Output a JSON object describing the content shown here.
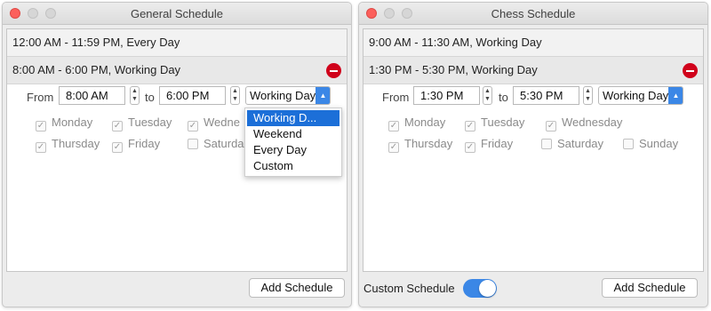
{
  "left": {
    "title": "General Schedule",
    "rows": [
      {
        "label": "12:00 AM - 11:59 PM, Every Day"
      },
      {
        "label": "8:00 AM - 6:00 PM, Working Day"
      }
    ],
    "editor": {
      "from_label": "From",
      "to_label": "to",
      "from_value": "8:00 AM",
      "to_value": "6:00 PM",
      "select_value": "Working Day",
      "days": [
        {
          "label": "Monday",
          "checked": true
        },
        {
          "label": "Tuesday",
          "checked": true
        },
        {
          "label": "Wedne",
          "checked": true
        },
        {
          "label": "Thursday",
          "checked": true
        },
        {
          "label": "Friday",
          "checked": true
        },
        {
          "label": "Saturda",
          "checked": false
        }
      ]
    },
    "dropdown": {
      "options": [
        "Working D...",
        "Weekend",
        "Every Day",
        "Custom"
      ],
      "selected_index": 0
    },
    "add_button": "Add Schedule"
  },
  "right": {
    "title": "Chess Schedule",
    "rows": [
      {
        "label": "9:00 AM - 11:30 AM, Working Day"
      },
      {
        "label": "1:30 PM - 5:30 PM, Working Day"
      }
    ],
    "editor": {
      "from_label": "From",
      "to_label": "to",
      "from_value": "1:30 PM",
      "to_value": "5:30 PM",
      "select_value": "Working Day",
      "days": [
        {
          "label": "Monday",
          "checked": true
        },
        {
          "label": "Tuesday",
          "checked": true
        },
        {
          "label": "Wednesday",
          "checked": true
        },
        {
          "label": "Thursday",
          "checked": true
        },
        {
          "label": "Friday",
          "checked": true
        },
        {
          "label": "Saturday",
          "checked": false
        },
        {
          "label": "Sunday",
          "checked": false
        }
      ]
    },
    "custom_schedule_label": "Custom Schedule",
    "custom_schedule_on": true,
    "add_button": "Add Schedule"
  },
  "colors": {
    "accent": "#3b87e6",
    "remove": "#d0021b",
    "selection": "#1c6fd8"
  },
  "icons": {
    "remove": "minus-circle-icon",
    "stepper": "up-down-stepper-icon",
    "select_arrow": "chevron-updown-icon"
  }
}
